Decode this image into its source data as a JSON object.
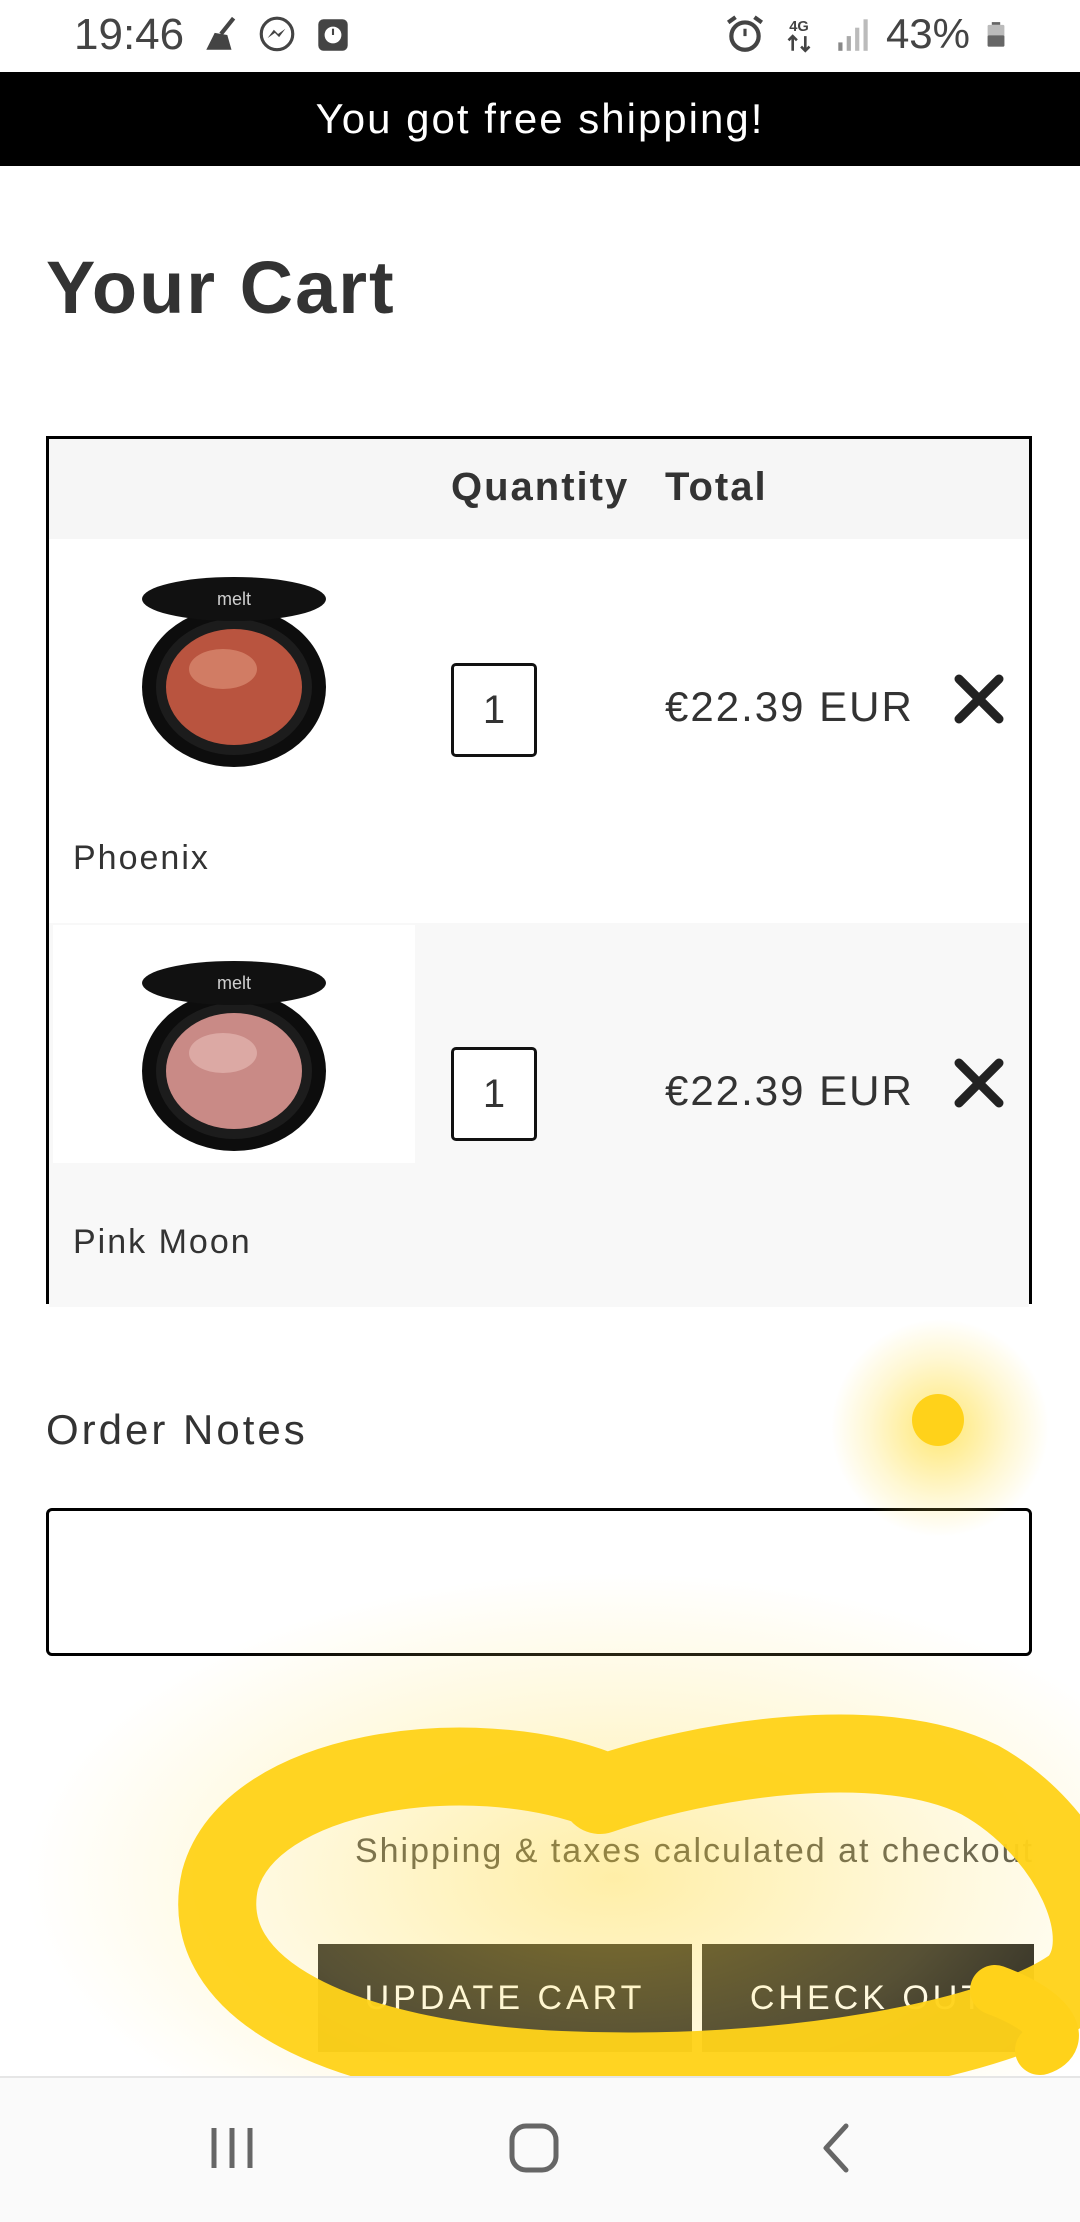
{
  "status_bar": {
    "time": "19:46",
    "battery": "43%"
  },
  "banner": {
    "text": "You got free shipping!"
  },
  "page_title": "Your Cart",
  "cart": {
    "headers": {
      "quantity": "Quantity",
      "total": "Total"
    },
    "items": [
      {
        "name": "Phoenix",
        "quantity": "1",
        "price": "€22.39 EUR",
        "color": "#b9543f"
      },
      {
        "name": "Pink Moon",
        "quantity": "1",
        "price": "€22.39 EUR",
        "color": "#c98a86"
      }
    ]
  },
  "order_notes": {
    "label": "Order Notes",
    "value": ""
  },
  "subtotal_partial": "",
  "shipping_note": "Shipping & taxes calculated at checkout",
  "buttons": {
    "update": "UPDATE CART",
    "checkout": "CHECK OUT"
  },
  "colors": {
    "banner_bg": "#000000",
    "highlight": "#ffd21a",
    "button_bg": "#1f1f1f"
  },
  "icons": {
    "status_left": [
      "broom-icon",
      "messenger-icon",
      "clock-app-icon"
    ],
    "status_right": [
      "alarm-icon",
      "4g-icon",
      "signal-icon",
      "battery-icon"
    ],
    "nav": [
      "recents-icon",
      "home-icon",
      "back-icon"
    ]
  }
}
